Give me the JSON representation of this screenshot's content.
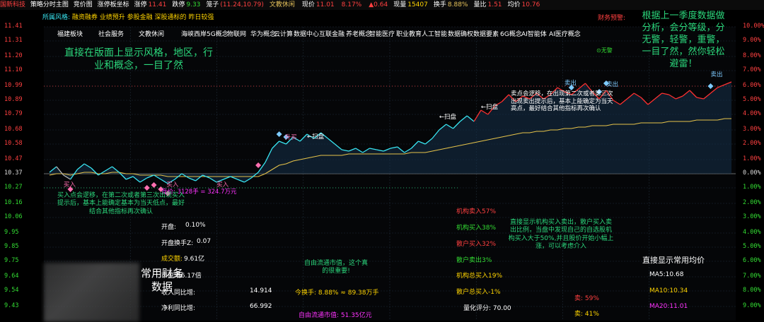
{
  "topbar": {
    "stock_name": "国新科技",
    "tabs": [
      "策略分时主图",
      "竞价图",
      "涨停板坐标"
    ],
    "stats": [
      {
        "label": "涨停",
        "value": "11.41",
        "color": "#ff4040"
      },
      {
        "label": "跌停",
        "value": "9.33",
        "color": "#33dd33"
      },
      {
        "label": "笼子",
        "value": "(11.24,10.79)",
        "color": "#ff4040"
      },
      {
        "label": "文教休闲",
        "value": "",
        "color": "#e5c15a"
      },
      {
        "label": "现价",
        "value": "11.01",
        "color": "#ff4040"
      },
      {
        "label": "",
        "value": "8.17%",
        "color": "#ff4040"
      },
      {
        "label": "",
        "value": "▲0.64",
        "color": "#ff4040"
      },
      {
        "label": "现量",
        "value": "15407",
        "color": "#ffd400"
      },
      {
        "label": "换手",
        "value": "8.88%",
        "color": "#e5c15a"
      },
      {
        "label": "量比",
        "value": "1.51",
        "color": "#ff4040"
      },
      {
        "label": "均价",
        "value": "10.76",
        "color": "#ff4040"
      }
    ]
  },
  "style_line": {
    "prefix": "所属风格:",
    "items": [
      "融资融券",
      "业绩预升",
      "参股金融",
      "深股通标的",
      "昨日较强"
    ]
  },
  "finance_alert": "财务预警:",
  "concepts": [
    "福建板块",
    "社会服务",
    "文教休闲",
    "海峡西岸",
    "5G概念",
    "物联网",
    "华为概念",
    "云计算",
    "数据中心",
    "互联金融",
    "养老概念",
    "智能医疗",
    "职业教育",
    "人工智能",
    "数据确权",
    "数据要素",
    "6G概念",
    "AI智能体",
    "AI医疗概念"
  ],
  "no_alert": "⊙无警",
  "annotations": {
    "style_region": "直接在版面上显示风格，地区，行业和概念，一目了然",
    "season_data": "根据上一季度数据做分析，会分等级，分无警，轻警，重警，一目了然，然你轻松避雷！",
    "institution_sell": "卖点会逻移，在出现第二次或者第三次出现卖出提示后，基本上能确定为当天高点，最好结合其他指标再次确认",
    "buy_point": "买入点会逻移，在第二次或者第三次出现买入提示后，基本上能确定基本为当天低点，最好结合其他指标再次确认",
    "institution_show": "直接显示机构买入卖出，散户买入卖出比例，当盘中发现自己的自选股机构买入大于50%,并且股价开始小幅上涨，可以考虑介入",
    "common_finance": "常用财务数据",
    "free_cap_note": "自由流通市值，这个真的很重要!",
    "common_ma": "直接显示常用均价"
  },
  "chart_markers": {
    "buy": "买入",
    "sell": "卖出",
    "sweep": "←扫盘",
    "rise_buy": "升买",
    "buy_big": "竞价: 3128手 = 324.7万元"
  },
  "chart_data": {
    "type": "line",
    "title": "",
    "prev_close": 10.37,
    "ylim": [
      9.33,
      11.41
    ],
    "left_ticks": [
      "11.41",
      "11.31",
      "11.20",
      "11.10",
      "10.99",
      "10.89",
      "10.79",
      "10.68",
      "10.58",
      "10.47",
      "10.37",
      "10.27",
      "10.16",
      "10.06",
      "9.95",
      "9.85",
      "9.75",
      "9.64",
      "9.54",
      "9.43"
    ],
    "right_ticks": [
      "10.00%",
      "9.00%",
      "8.00%",
      "7.00%",
      "6.00%",
      "5.00%",
      "4.00%",
      "3.00%",
      "2.00%",
      "1.00%",
      "0.00%",
      "1.00%",
      "2.00%",
      "3.00%",
      "4.00%",
      "5.00%",
      "6.00%",
      "7.00%",
      "8.00%",
      "9.00%"
    ],
    "series": [
      {
        "values": [
          10.38,
          10.42,
          10.36,
          10.33,
          10.4,
          10.44,
          10.41,
          10.36,
          10.39,
          10.42,
          10.38,
          10.33,
          10.35,
          10.31,
          10.34,
          10.36,
          10.33,
          10.3,
          10.33,
          10.37,
          10.34,
          10.32,
          10.36,
          10.34,
          10.31,
          10.33,
          10.35,
          10.33,
          10.31,
          10.34,
          10.38,
          10.45,
          10.55,
          10.6,
          10.58,
          10.63,
          10.6,
          10.65,
          10.62,
          10.66,
          10.62,
          10.58,
          10.54,
          10.53,
          10.55,
          10.52,
          10.55,
          10.54,
          10.53,
          10.55,
          10.56,
          10.52,
          10.55,
          10.6,
          10.58,
          10.62,
          10.68,
          10.72,
          10.69,
          10.74,
          10.78,
          10.74,
          10.82,
          10.79,
          10.85,
          10.88,
          10.93,
          10.88,
          10.92,
          10.9,
          10.94,
          10.9,
          10.93,
          10.98,
          10.95,
          10.93,
          10.97,
          11.01,
          10.95,
          10.9,
          10.96,
          10.89,
          10.86,
          10.9,
          10.94,
          10.91,
          10.86,
          10.9,
          10.94,
          10.93,
          10.9,
          10.92,
          10.96,
          10.91,
          10.9,
          10.94,
          10.98,
          11.0,
          11.02
        ]
      }
    ],
    "average": [
      10.36,
      10.37,
      10.37,
      10.36,
      10.37,
      10.38,
      10.38,
      10.37,
      10.37,
      10.38,
      10.38,
      10.37,
      10.37,
      10.36,
      10.36,
      10.36,
      10.36,
      10.35,
      10.35,
      10.35,
      10.35,
      10.35,
      10.35,
      10.35,
      10.35,
      10.35,
      10.35,
      10.35,
      10.35,
      10.35,
      10.35,
      10.37,
      10.4,
      10.43,
      10.44,
      10.46,
      10.47,
      10.48,
      10.49,
      10.5,
      10.5,
      10.5,
      10.5,
      10.51,
      10.51,
      10.51,
      10.51,
      10.51,
      10.51,
      10.51,
      10.51,
      10.51,
      10.52,
      10.52,
      10.52,
      10.53,
      10.54,
      10.55,
      10.56,
      10.57,
      10.58,
      10.59,
      10.6,
      10.61,
      10.62,
      10.63,
      10.64,
      10.65,
      10.66,
      10.66,
      10.67,
      10.67,
      10.68,
      10.68,
      10.69,
      10.69,
      10.7,
      10.7,
      10.71,
      10.71,
      10.71,
      10.72,
      10.72,
      10.72,
      10.72,
      10.73,
      10.73,
      10.73,
      10.73,
      10.74,
      10.74,
      10.74,
      10.74,
      10.75,
      10.75,
      10.75,
      10.75,
      10.76,
      10.76
    ],
    "grid": true
  },
  "finance": {
    "rows": [
      {
        "label": "开盘:",
        "value": "0.10%"
      },
      {
        "label": "开盘换手Z:",
        "value": "0.07"
      },
      {
        "label": "成交额:",
        "value": "9.61亿"
      },
      {
        "label": "市盈率:",
        "value": "56.17倍"
      },
      {
        "label": "收入同比增:",
        "value": "14.914"
      },
      {
        "label": "净利同比增:",
        "value": "66.992"
      }
    ],
    "turnover_today": "今换手: 8.88% ≈ 89.38万手",
    "free_cap": "自由流通市值: 51.35亿元"
  },
  "institution": {
    "rows": [
      {
        "label": "机构卖入57%",
        "color": "#ff4040"
      },
      {
        "label": "机构买入38%",
        "color": "#33dd33"
      },
      {
        "label": "散户买入32%",
        "color": "#ff4040"
      },
      {
        "label": "散户卖出3%",
        "color": "#33dd33"
      },
      {
        "label": "机构总买入19%",
        "color": "#ffd400"
      },
      {
        "label": "散户总买入-1%",
        "color": "#ffd400"
      }
    ],
    "rating": "量化评分: 70.00"
  },
  "ma": {
    "rows": [
      {
        "label": "MA5:10.68",
        "color": "#ffffff"
      },
      {
        "label": "MA10:10.34",
        "color": "#ffd400"
      },
      {
        "label": "MA20:11.01",
        "color": "#ff33ff"
      },
      {
        "label": "MA60:9.84",
        "color": "#33dd33"
      }
    ],
    "sell_pct": "卖: 59%",
    "buy_pct": "卖: 41%"
  },
  "colors": {
    "up": "#ff3030",
    "down": "#22cc22",
    "cyan": "#39e6f2",
    "avg": "#e6c34a",
    "annotation": "#2bd67b"
  }
}
